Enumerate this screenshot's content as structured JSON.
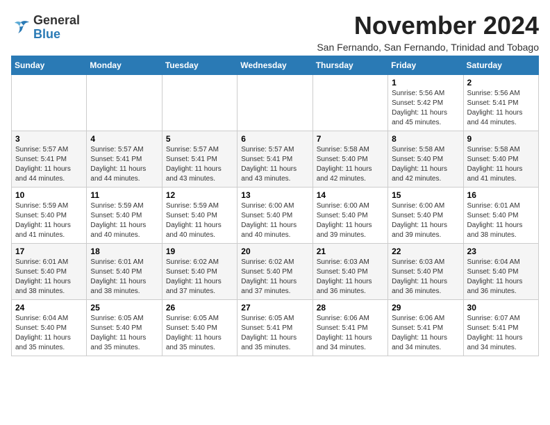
{
  "logo": {
    "general": "General",
    "blue": "Blue"
  },
  "header": {
    "month_year": "November 2024",
    "subtitle": "San Fernando, San Fernando, Trinidad and Tobago"
  },
  "weekdays": [
    "Sunday",
    "Monday",
    "Tuesday",
    "Wednesday",
    "Thursday",
    "Friday",
    "Saturday"
  ],
  "rows": [
    [
      {
        "day": "",
        "sunrise": "",
        "sunset": "",
        "daylight": ""
      },
      {
        "day": "",
        "sunrise": "",
        "sunset": "",
        "daylight": ""
      },
      {
        "day": "",
        "sunrise": "",
        "sunset": "",
        "daylight": ""
      },
      {
        "day": "",
        "sunrise": "",
        "sunset": "",
        "daylight": ""
      },
      {
        "day": "",
        "sunrise": "",
        "sunset": "",
        "daylight": ""
      },
      {
        "day": "1",
        "sunrise": "Sunrise: 5:56 AM",
        "sunset": "Sunset: 5:42 PM",
        "daylight": "Daylight: 11 hours and 45 minutes."
      },
      {
        "day": "2",
        "sunrise": "Sunrise: 5:56 AM",
        "sunset": "Sunset: 5:41 PM",
        "daylight": "Daylight: 11 hours and 44 minutes."
      }
    ],
    [
      {
        "day": "3",
        "sunrise": "Sunrise: 5:57 AM",
        "sunset": "Sunset: 5:41 PM",
        "daylight": "Daylight: 11 hours and 44 minutes."
      },
      {
        "day": "4",
        "sunrise": "Sunrise: 5:57 AM",
        "sunset": "Sunset: 5:41 PM",
        "daylight": "Daylight: 11 hours and 44 minutes."
      },
      {
        "day": "5",
        "sunrise": "Sunrise: 5:57 AM",
        "sunset": "Sunset: 5:41 PM",
        "daylight": "Daylight: 11 hours and 43 minutes."
      },
      {
        "day": "6",
        "sunrise": "Sunrise: 5:57 AM",
        "sunset": "Sunset: 5:41 PM",
        "daylight": "Daylight: 11 hours and 43 minutes."
      },
      {
        "day": "7",
        "sunrise": "Sunrise: 5:58 AM",
        "sunset": "Sunset: 5:40 PM",
        "daylight": "Daylight: 11 hours and 42 minutes."
      },
      {
        "day": "8",
        "sunrise": "Sunrise: 5:58 AM",
        "sunset": "Sunset: 5:40 PM",
        "daylight": "Daylight: 11 hours and 42 minutes."
      },
      {
        "day": "9",
        "sunrise": "Sunrise: 5:58 AM",
        "sunset": "Sunset: 5:40 PM",
        "daylight": "Daylight: 11 hours and 41 minutes."
      }
    ],
    [
      {
        "day": "10",
        "sunrise": "Sunrise: 5:59 AM",
        "sunset": "Sunset: 5:40 PM",
        "daylight": "Daylight: 11 hours and 41 minutes."
      },
      {
        "day": "11",
        "sunrise": "Sunrise: 5:59 AM",
        "sunset": "Sunset: 5:40 PM",
        "daylight": "Daylight: 11 hours and 40 minutes."
      },
      {
        "day": "12",
        "sunrise": "Sunrise: 5:59 AM",
        "sunset": "Sunset: 5:40 PM",
        "daylight": "Daylight: 11 hours and 40 minutes."
      },
      {
        "day": "13",
        "sunrise": "Sunrise: 6:00 AM",
        "sunset": "Sunset: 5:40 PM",
        "daylight": "Daylight: 11 hours and 40 minutes."
      },
      {
        "day": "14",
        "sunrise": "Sunrise: 6:00 AM",
        "sunset": "Sunset: 5:40 PM",
        "daylight": "Daylight: 11 hours and 39 minutes."
      },
      {
        "day": "15",
        "sunrise": "Sunrise: 6:00 AM",
        "sunset": "Sunset: 5:40 PM",
        "daylight": "Daylight: 11 hours and 39 minutes."
      },
      {
        "day": "16",
        "sunrise": "Sunrise: 6:01 AM",
        "sunset": "Sunset: 5:40 PM",
        "daylight": "Daylight: 11 hours and 38 minutes."
      }
    ],
    [
      {
        "day": "17",
        "sunrise": "Sunrise: 6:01 AM",
        "sunset": "Sunset: 5:40 PM",
        "daylight": "Daylight: 11 hours and 38 minutes."
      },
      {
        "day": "18",
        "sunrise": "Sunrise: 6:01 AM",
        "sunset": "Sunset: 5:40 PM",
        "daylight": "Daylight: 11 hours and 38 minutes."
      },
      {
        "day": "19",
        "sunrise": "Sunrise: 6:02 AM",
        "sunset": "Sunset: 5:40 PM",
        "daylight": "Daylight: 11 hours and 37 minutes."
      },
      {
        "day": "20",
        "sunrise": "Sunrise: 6:02 AM",
        "sunset": "Sunset: 5:40 PM",
        "daylight": "Daylight: 11 hours and 37 minutes."
      },
      {
        "day": "21",
        "sunrise": "Sunrise: 6:03 AM",
        "sunset": "Sunset: 5:40 PM",
        "daylight": "Daylight: 11 hours and 36 minutes."
      },
      {
        "day": "22",
        "sunrise": "Sunrise: 6:03 AM",
        "sunset": "Sunset: 5:40 PM",
        "daylight": "Daylight: 11 hours and 36 minutes."
      },
      {
        "day": "23",
        "sunrise": "Sunrise: 6:04 AM",
        "sunset": "Sunset: 5:40 PM",
        "daylight": "Daylight: 11 hours and 36 minutes."
      }
    ],
    [
      {
        "day": "24",
        "sunrise": "Sunrise: 6:04 AM",
        "sunset": "Sunset: 5:40 PM",
        "daylight": "Daylight: 11 hours and 35 minutes."
      },
      {
        "day": "25",
        "sunrise": "Sunrise: 6:05 AM",
        "sunset": "Sunset: 5:40 PM",
        "daylight": "Daylight: 11 hours and 35 minutes."
      },
      {
        "day": "26",
        "sunrise": "Sunrise: 6:05 AM",
        "sunset": "Sunset: 5:40 PM",
        "daylight": "Daylight: 11 hours and 35 minutes."
      },
      {
        "day": "27",
        "sunrise": "Sunrise: 6:05 AM",
        "sunset": "Sunset: 5:41 PM",
        "daylight": "Daylight: 11 hours and 35 minutes."
      },
      {
        "day": "28",
        "sunrise": "Sunrise: 6:06 AM",
        "sunset": "Sunset: 5:41 PM",
        "daylight": "Daylight: 11 hours and 34 minutes."
      },
      {
        "day": "29",
        "sunrise": "Sunrise: 6:06 AM",
        "sunset": "Sunset: 5:41 PM",
        "daylight": "Daylight: 11 hours and 34 minutes."
      },
      {
        "day": "30",
        "sunrise": "Sunrise: 6:07 AM",
        "sunset": "Sunset: 5:41 PM",
        "daylight": "Daylight: 11 hours and 34 minutes."
      }
    ]
  ]
}
